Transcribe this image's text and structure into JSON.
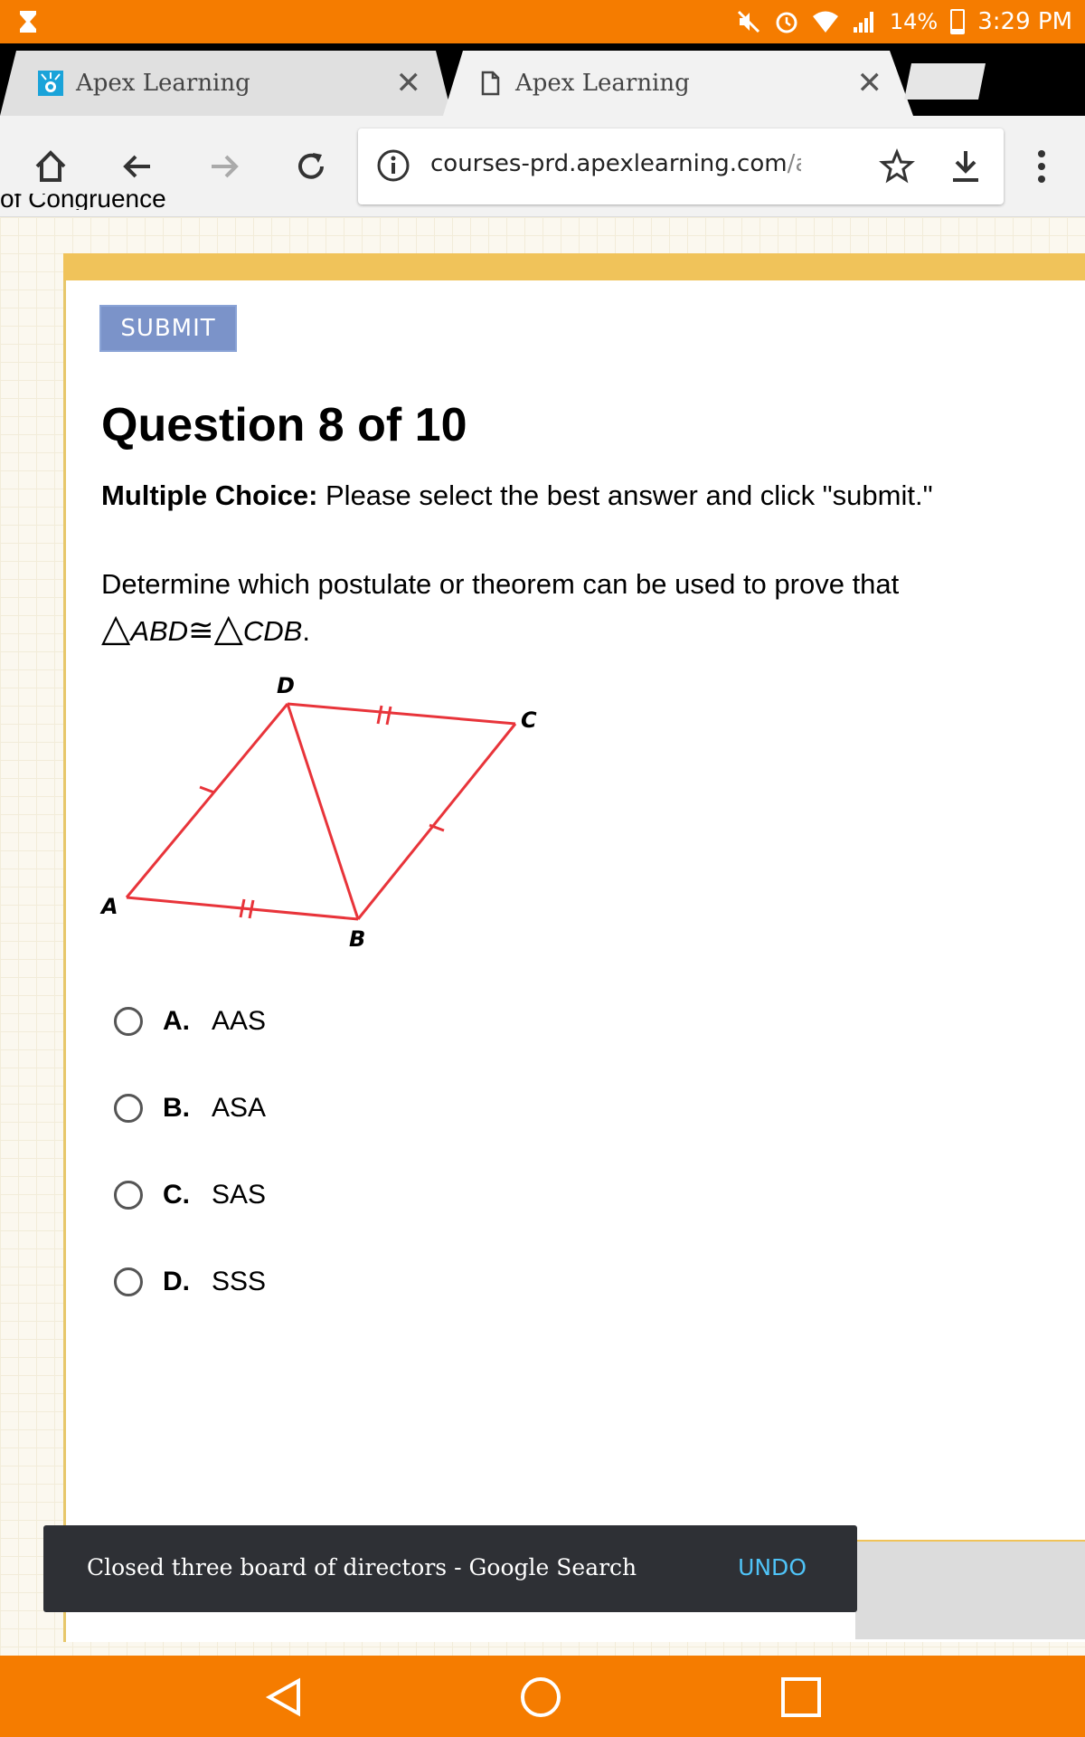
{
  "status_bar": {
    "battery_percent": "14%",
    "time": "3:29 PM",
    "icons": [
      "hourglass-icon",
      "mute-icon",
      "alarm-icon",
      "wifi-icon",
      "signal-icon",
      "battery-icon"
    ]
  },
  "tabs": [
    {
      "title": "Apex Learning",
      "icon": "apex-logo-icon"
    },
    {
      "title": "Apex Learning",
      "icon": "page-icon"
    }
  ],
  "toolbar": {
    "url_host": "courses-prd.apexlearning.com",
    "url_rest": "/apps..."
  },
  "page": {
    "cut_heading": "of Congruence",
    "submit_label": "SUBMIT",
    "question_title": "Question 8 of 10",
    "instructions_label": "Multiple Choice:",
    "instructions_text": " Please select the best answer and click \"submit.\"",
    "prompt_text": "Determine which postulate or theorem can be used to prove that",
    "prompt_tri1": "ABD",
    "prompt_congruent": "≅",
    "prompt_tri2": "CDB",
    "prompt_end": "."
  },
  "figure": {
    "labels": {
      "A": "A",
      "B": "B",
      "C": "C",
      "D": "D"
    },
    "color": "#e8343a"
  },
  "options": [
    {
      "letter": "A.",
      "text": "AAS"
    },
    {
      "letter": "B.",
      "text": "ASA"
    },
    {
      "letter": "C.",
      "text": "SAS"
    },
    {
      "letter": "D.",
      "text": "SSS"
    }
  ],
  "snackbar": {
    "message": "Closed three board of directors - Google Search",
    "action": "UNDO"
  },
  "colors": {
    "status_bar": "#f57c00",
    "submit_button": "#7b93c9",
    "card_accent": "#f0c35a",
    "snackbar_action": "#4fc3f7"
  }
}
